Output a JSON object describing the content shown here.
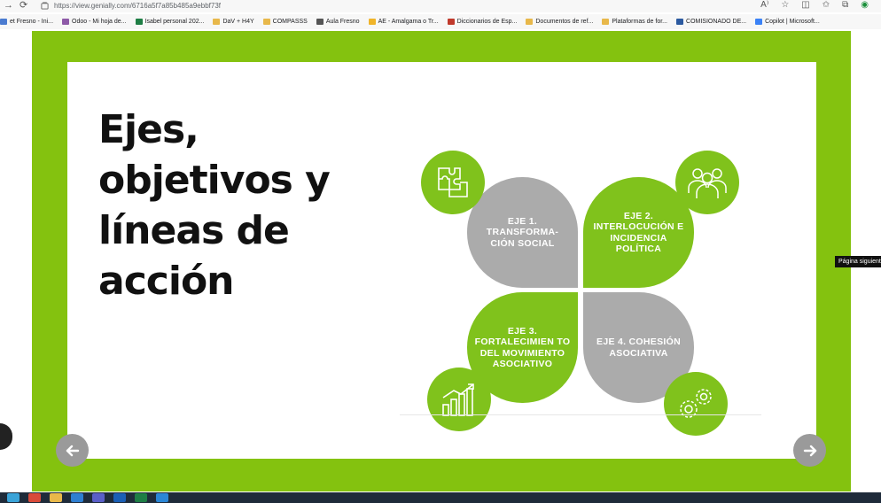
{
  "browser": {
    "url": "https://view.genially.com/6716a5f7a85b485a9ebbf73f",
    "bookmarks": [
      {
        "label": "et Fresno - Ini...",
        "icon": "favicon-icon",
        "color": "#4a7bd0"
      },
      {
        "label": "Odoo - Mi hoja de...",
        "icon": "odoo-icon",
        "color": "#8e5aa8"
      },
      {
        "label": "Isabel personal 202...",
        "icon": "sheet-icon",
        "color": "#1e7e45"
      },
      {
        "label": "DaV + H4Y",
        "icon": "folder-icon",
        "color": "#e8b84a"
      },
      {
        "label": "COMPASSS",
        "icon": "folder-icon",
        "color": "#e8b84a"
      },
      {
        "label": "Aula Fresno",
        "icon": "favicon-icon",
        "color": "#555555"
      },
      {
        "label": "AE - Amalgama o Tr...",
        "icon": "favicon-icon",
        "color": "#f0b429"
      },
      {
        "label": "Diccionarios de Esp...",
        "icon": "favicon-icon",
        "color": "#c0392b"
      },
      {
        "label": "Documentos de ref...",
        "icon": "folder-icon",
        "color": "#e8b84a"
      },
      {
        "label": "Plataformas de for...",
        "icon": "folder-icon",
        "color": "#e8b84a"
      },
      {
        "label": "COMISIONADO DE...",
        "icon": "favicon-icon",
        "color": "#2c5aa0"
      },
      {
        "label": "Copilot | Microsoft...",
        "icon": "copilot-icon",
        "color": "#3b82f6"
      }
    ]
  },
  "slide": {
    "title": "Ejes, objetivos y líneas de acción",
    "axes": [
      {
        "label": "EJE 1. TRANSFORMA- CIÓN SOCIAL",
        "color": "#ababab",
        "icon": "puzzle-icon"
      },
      {
        "label": "EJE 2. INTERLOCUCIÓN E INCIDENCIA POLÍTICA",
        "color": "#80c21c",
        "icon": "people-icon"
      },
      {
        "label": "EJE 3. FORTALECIMIEN TO DEL MOVIMIENTO ASOCIATIVO",
        "color": "#80c21c",
        "icon": "growth-chart-icon"
      },
      {
        "label": "EJE 4. COHESIÓN ASOCIATIVA",
        "color": "#ababab",
        "icon": "gears-icon"
      }
    ]
  },
  "navigation": {
    "prev_icon": "arrow-left-icon",
    "next_icon": "arrow-right-icon",
    "next_tooltip": "Página siguiente"
  },
  "colors": {
    "frame": "#84c20f",
    "accent_green": "#80c21c",
    "accent_gray": "#ababab"
  }
}
